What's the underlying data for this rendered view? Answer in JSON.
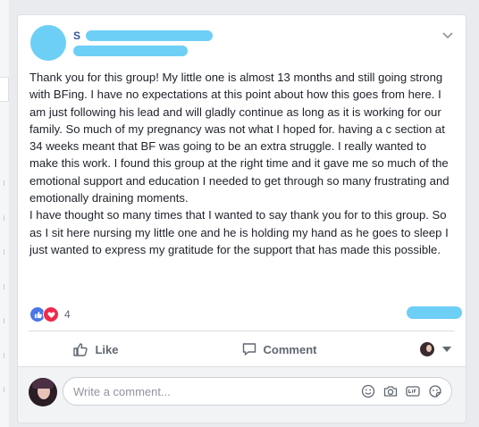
{
  "post": {
    "author": "S",
    "text": "Thank you for this group! My little one is almost 13 months and still going strong with BFing. I have no expectations at this point about how this goes from here. I am just following his lead and will gladly continue as long as it is working for our family. So much of my pregnancy was not what I hoped for. having a c section at 34 weeks meant that BF was going to be an extra struggle. I really wanted to make this work. I found this group at the right time and it gave me so much of the emotional support and education I needed to get through so many frustrating and emotionally draining moments.\nI have thought so many times that I wanted to say thank you for to this group. So as I sit here nursing my little one and he is holding my hand as he goes to sleep I just wanted to express my gratitude for the support that has made this possible.",
    "reaction_count": "4"
  },
  "actions": {
    "like_label": "Like",
    "comment_label": "Comment"
  },
  "composer": {
    "placeholder": "Write a comment..."
  },
  "icons": {
    "reactions": [
      "like-reaction-icon",
      "love-reaction-icon"
    ],
    "composer": [
      "emoji-icon",
      "camera-icon",
      "gif-icon",
      "sticker-icon"
    ]
  },
  "colors": {
    "link": "#365899",
    "like_blue": "#4a76e8",
    "love_red": "#f0284a",
    "redaction": "#6dcff6"
  }
}
